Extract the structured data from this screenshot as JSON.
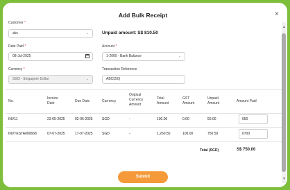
{
  "modal": {
    "title": "Add Bulk Receipt",
    "close_label": "×"
  },
  "form": {
    "customer_label": "Customer",
    "customer_value": "abc",
    "unpaid_text": "Unpaid amount: S$ 810.50",
    "date_paid_label": "Date Paid",
    "date_paid_value": "08-Jul-2025",
    "account_label": "Account",
    "account_value": "1-2000 - Bank Balance",
    "currency_label": "Currency",
    "currency_value": "SGD - Singapore Dollar",
    "txn_ref_label": "Transaction Reference",
    "txn_ref_value": "ABC550|",
    "required_mark": "*"
  },
  "table": {
    "headers": {
      "no": "No.",
      "invoice_date": [
        "Invoice",
        "Date"
      ],
      "due_date": "Due Date",
      "currency": "Currency",
      "original": [
        "Original",
        "Currency",
        "Amount"
      ],
      "total": [
        "Total",
        "Amount"
      ],
      "gst": [
        "GST",
        "Amount"
      ],
      "unpaid": [
        "Unpaid",
        "Amount"
      ],
      "paid": "Amount Paid"
    },
    "rows": [
      {
        "no": "INV11",
        "invoice_date": "23-05-2025",
        "due_date": "02-06-2025",
        "currency": "SGD",
        "original": "-",
        "total": "100.00",
        "gst": "0.00",
        "unpaid": "50.00",
        "paid": "050"
      },
      {
        "no": "INVTESTA000668",
        "invoice_date": "07-07-2025",
        "due_date": "17-07-2025",
        "currency": "SGD",
        "original": "-",
        "total": "1,260.50",
        "gst": "100.00",
        "unpaid": "750.50",
        "paid": "0700"
      }
    ],
    "total_label": "Total (SGD)",
    "total_value": "S$ 750.00"
  },
  "submit_label": "Submit",
  "colors": {
    "accent": "#f59a3a",
    "frame": "#7dbf3a",
    "required": "#e23b3b"
  }
}
